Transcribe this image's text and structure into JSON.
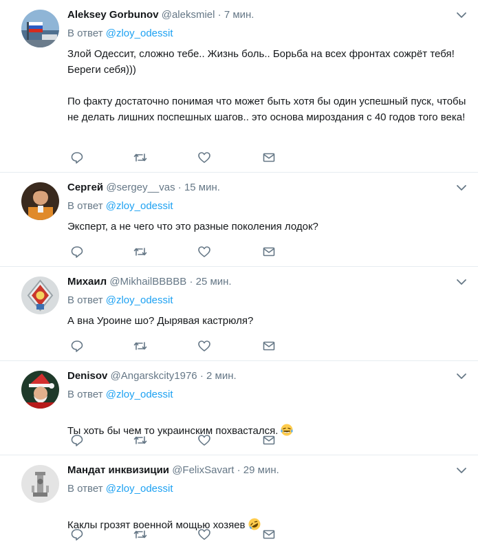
{
  "reply_prefix": "В ответ",
  "reply_target": "@zloy_odessit",
  "dot": "·",
  "tweets": [
    {
      "name": "Aleksey Gorbunov",
      "handle": "@aleksmiel",
      "time": "7 мин.",
      "text": "Злой Одессит, сложно тебе.. Жизнь боль.. Борьба на всех фронтах сожрёт тебя! Береги себя)))\n\nПо факту достаточно понимая что может быть хотя бы один успешный пуск, чтобы не делать лишних поспешных шагов.. это основа мироздания с 40 годов того века!",
      "emoji": ""
    },
    {
      "name": "Сергей",
      "handle": "@sergey__vas",
      "time": "15 мин.",
      "text": "Эксперт, а не чего что это разные поколения лодок?",
      "emoji": ""
    },
    {
      "name": "Михаил",
      "handle": "@MikhailBBBBB",
      "time": "25 мин.",
      "text": "А вна Уроине шо? Дырявая кастрюля?",
      "emoji": ""
    },
    {
      "name": "Denisov",
      "handle": "@Angarskcity1976",
      "time": "2 мин.",
      "text": "Ты хоть бы чем то украинским похвастался.",
      "emoji": "crying-laughing-emoji"
    },
    {
      "name": "Мандат инквизиции",
      "handle": "@FelixSavart",
      "time": "29 мин.",
      "text": "Каклы грозят военной мощью хозяев",
      "emoji": "rolling-laughing-emoji"
    }
  ],
  "colors": {
    "link": "#1da1f2",
    "muted": "#657786",
    "text": "#14171a",
    "divider": "#e6ecf0"
  }
}
